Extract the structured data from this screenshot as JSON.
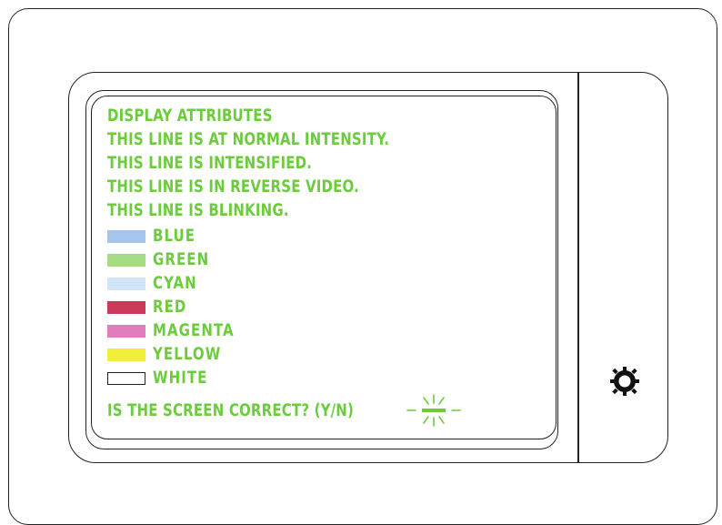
{
  "screen": {
    "lines": [
      "DISPLAY ATTRIBUTES",
      "THIS LINE IS AT NORMAL INTENSITY.",
      "THIS LINE IS INTENSIFIED.",
      "THIS LINE IS IN REVERSE VIDEO.",
      "THIS LINE IS BLINKING."
    ],
    "colors": [
      {
        "label": "BLUE",
        "swatch": "#a7c4ec"
      },
      {
        "label": "GREEN",
        "swatch": "#a6dc86"
      },
      {
        "label": "CYAN",
        "swatch": "#d2e4f7"
      },
      {
        "label": "RED",
        "swatch": "#c93a5a"
      },
      {
        "label": "MAGENTA",
        "swatch": "#e17cbd"
      },
      {
        "label": "YELLOW",
        "swatch": "#f2ef3a"
      },
      {
        "label": "WHITE",
        "swatch": "#ffffff"
      }
    ],
    "prompt": "IS THE SCREEN CORRECT? (Y/N)",
    "text_color": "#6ccc3d"
  },
  "icons": {
    "cursor": "blinking-cursor-icon",
    "knob": "brightness-knob-icon"
  }
}
